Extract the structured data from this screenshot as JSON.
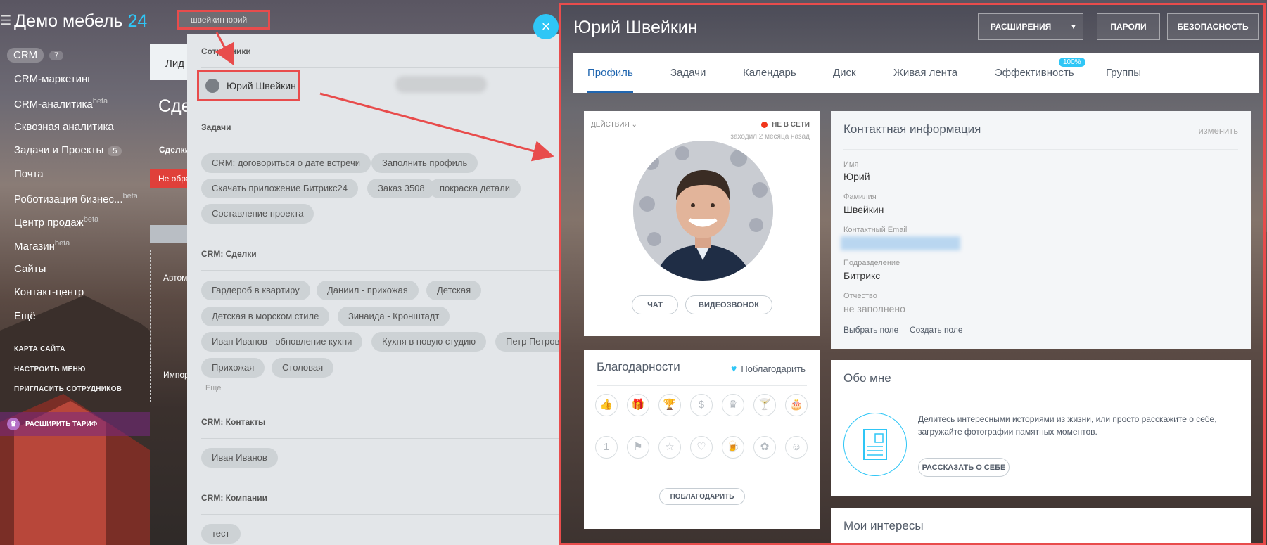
{
  "sidebar": {
    "logo_name": "Демо мебель",
    "logo_num": "24",
    "crm_label": "CRM",
    "crm_count": "7",
    "items": [
      {
        "label": "CRM-маркетинг",
        "sup": ""
      },
      {
        "label": "CRM-аналитика",
        "sup": "beta"
      },
      {
        "label": "Сквозная аналитика",
        "sup": ""
      },
      {
        "label": "Задачи и Проекты",
        "sup": "",
        "count": "5"
      },
      {
        "label": "Почта",
        "sup": ""
      },
      {
        "label": "Роботизация бизнес...",
        "sup": "beta"
      },
      {
        "label": "Центр продаж",
        "sup": "beta"
      },
      {
        "label": "Магазин",
        "sup": "beta"
      },
      {
        "label": "Сайты",
        "sup": ""
      },
      {
        "label": "Контакт-центр",
        "sup": ""
      },
      {
        "label": "Ещё",
        "sup": ""
      }
    ],
    "links": [
      "КАРТА САЙТА",
      "НАСТРОИТЬ МЕНЮ",
      "ПРИГЛАСИТЬ СОТРУДНИКОВ"
    ],
    "expand_label": "РАСШИРИТЬ ТАРИФ"
  },
  "background": {
    "tab_label": "Лид",
    "heading": "Сде",
    "deals_label": "Сделки",
    "not_processed": "Не обра",
    "box_text": "Автом",
    "import_text": "Импор"
  },
  "search": {
    "query": "швейкин юрий",
    "sections": {
      "employees": "Сотрудники",
      "tasks": "Задачи",
      "deals": "CRM: Сделки",
      "contacts": "CRM: Контакты",
      "companies": "CRM: Компании"
    },
    "employee": "Юрий Швейкин",
    "tasks": [
      "CRM: договориться о дате встречи",
      "Заполнить профиль",
      "Скачать приложение Битрикс24",
      "Заказ 3508",
      "покраска детали",
      "Составление проекта"
    ],
    "deals": [
      "Гардероб в квартиру",
      "Даниил - прихожая",
      "Детская",
      "Детская в морском стиле",
      "Зинаида - Кронштадт",
      "Иван Иванов - обновление кухни",
      "Кухня в новую студию",
      "Петр Петров",
      "Прихожая",
      "Столовая"
    ],
    "more": "Еще",
    "contacts": [
      "Иван Иванов"
    ],
    "companies": [
      "тест"
    ],
    "close_glyph": "×"
  },
  "profile": {
    "name": "Юрий Швейкин",
    "buttons": {
      "extensions": "РАСШИРЕНИЯ",
      "passwords": "ПАРОЛИ",
      "security": "БЕЗОПАСНОСТЬ"
    },
    "tabs": [
      "Профиль",
      "Задачи",
      "Календарь",
      "Диск",
      "Живая лента",
      "Эффективность",
      "Группы"
    ],
    "efficiency_badge": "100%",
    "actions": "ДЕЙСТВИЯ",
    "status": "НЕ В СЕТИ",
    "last_seen": "заходил 2 месяца назад",
    "chat": "ЧАТ",
    "videocall": "ВИДЕОЗВОНОК",
    "contact": {
      "title": "Контактная информация",
      "edit": "изменить",
      "fields": [
        {
          "label": "Имя",
          "value": "Юрий"
        },
        {
          "label": "Фамилия",
          "value": "Швейкин"
        },
        {
          "label": "Контактный Email",
          "value": ""
        },
        {
          "label": "Подразделение",
          "value": "Битрикс"
        },
        {
          "label": "Отчество",
          "value": "не заполнено"
        }
      ],
      "choose_field": "Выбрать поле",
      "create_field": "Создать поле"
    },
    "thanks": {
      "title": "Благодарности",
      "thank_link": "Поблагодарить",
      "button": "ПОБЛАГОДАРИТЬ",
      "icons": [
        "thumb-up-icon",
        "gift-icon",
        "trophy-icon",
        "money-bag-icon",
        "crown-icon",
        "cocktail-icon",
        "cake-icon",
        "number-one-icon",
        "flag-icon",
        "star-icon",
        "heart-icon",
        "beer-icon",
        "flower-icon",
        "smile-icon"
      ],
      "glyphs": [
        "👍",
        "🎁",
        "🏆",
        "$",
        "♛",
        "🍸",
        "🎂",
        "1",
        "⚑",
        "☆",
        "♡",
        "🍺",
        "✿",
        "☺"
      ]
    },
    "about": {
      "title": "Обо мне",
      "text": "Делитесь интересными историями из жизни, или просто расскажите о себе, загружайте фотографии памятных моментов.",
      "button": "РАССКАЗАТЬ О СЕБЕ"
    },
    "interests_title": "Мои интересы"
  }
}
